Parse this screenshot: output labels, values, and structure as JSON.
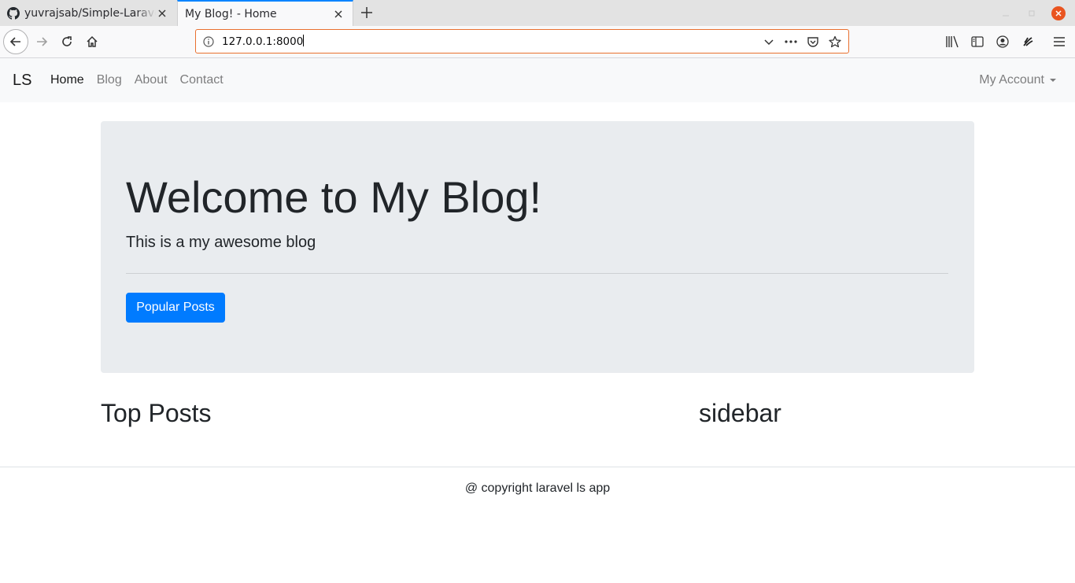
{
  "browser": {
    "tabs": [
      {
        "title": "yuvrajsab/Simple-Laravel-Blog",
        "icon": "github-icon",
        "active": false
      },
      {
        "title": "My Blog! - Home",
        "icon": "",
        "active": true
      }
    ],
    "url": "127.0.0.1:8000",
    "accent": "#0a84ff",
    "urlbar_focus_color": "#e9702f"
  },
  "site": {
    "brand": "LS",
    "nav_links": [
      "Home",
      "Blog",
      "About",
      "Contact"
    ],
    "active_link": "Home",
    "account_label": "My Account",
    "jumbotron": {
      "title": "Welcome to My Blog!",
      "lead": "This is a my awesome blog",
      "button_label": "Popular Posts",
      "button_color": "#007bff"
    },
    "main_heading": "Top Posts",
    "sidebar_heading": "sidebar",
    "footer": "@ copyright laravel ls app"
  }
}
